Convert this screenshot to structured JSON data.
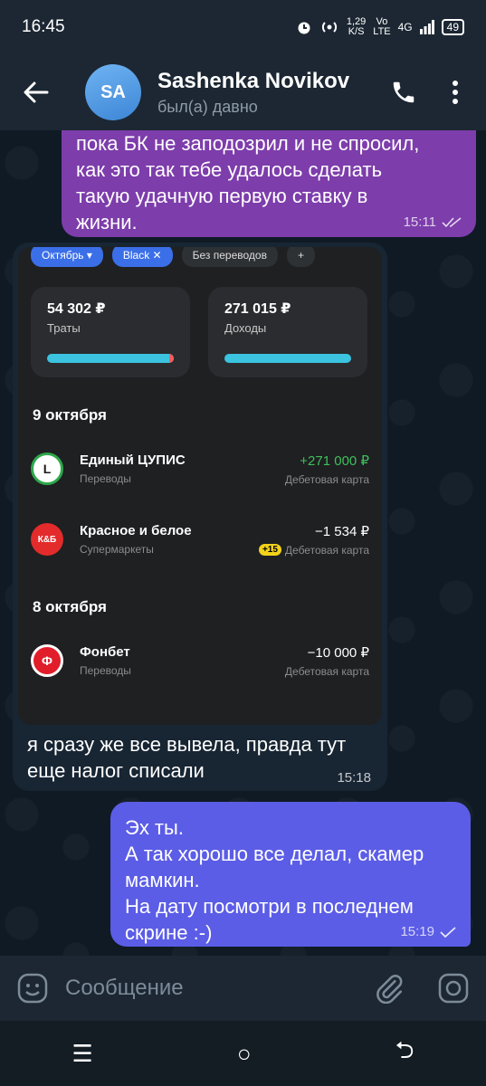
{
  "status_bar": {
    "time": "16:45",
    "speed_value": "1,29",
    "speed_unit": "K/S",
    "volte_top": "Vo",
    "volte_bottom": "LTE",
    "network": "4G",
    "battery": "49"
  },
  "header": {
    "avatar_initials": "SA",
    "contact_name": "Sashenka Novikov",
    "contact_status": "был(а) давно"
  },
  "messages": {
    "first": {
      "text": "пока БК не заподозрил и не спросил,\nкак это так тебе удалось сделать\nтакую удачную первую ставку в\nжизни.",
      "time": "15:11"
    },
    "received": {
      "text": "я сразу же все вывела, правда тут\nеще налог списали",
      "time": "15:18"
    },
    "reply": {
      "text": "Эх ты.\nА так хорошо все делал, скамер\nмамкин.\nНа дату посмотри в последнем\nскрине :-)",
      "time": "15:19"
    }
  },
  "screenshot": {
    "chips": [
      "Октябрь ▾",
      "Black ✕",
      "Без переводов",
      "+"
    ],
    "cards": [
      {
        "amount": "54 302 ₽",
        "label": "Траты"
      },
      {
        "amount": "271 015 ₽",
        "label": "Доходы"
      }
    ],
    "date1": "9 октября",
    "date2": "8 октября",
    "transactions": [
      {
        "logo": "L",
        "name": "Единый ЦУПИС",
        "category": "Переводы",
        "amount": "+271 000 ₽",
        "account": "Дебетовая карта"
      },
      {
        "logo": "К&Б",
        "name": "Красное и белое",
        "category": "Супермаркеты",
        "amount": "−1 534 ₽",
        "bonus": "+15",
        "account": "Дебетовая карта"
      },
      {
        "logo": "Ф",
        "name": "Фонбет",
        "category": "Переводы",
        "amount": "−10 000 ₽",
        "account": "Дебетовая карта"
      }
    ]
  },
  "composer": {
    "placeholder": "Сообщение"
  },
  "navbar": {
    "menu": "☰",
    "home": "○",
    "back": "⮌"
  },
  "colors": {
    "header_bg": "#1c2733",
    "bubble_purple": "#7d3dab",
    "bubble_blue": "#5b5de6",
    "income_green": "#3fbf5a"
  }
}
